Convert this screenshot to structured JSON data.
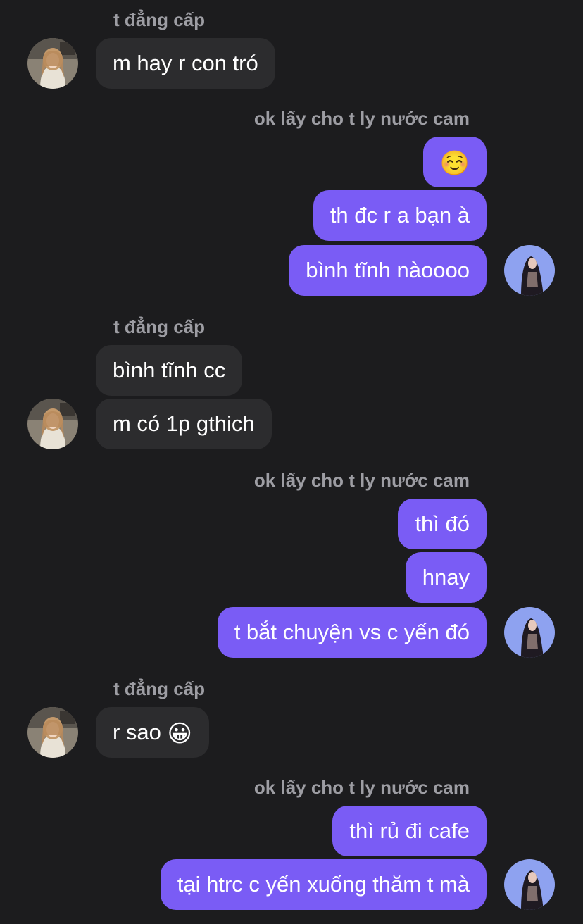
{
  "chat": {
    "senders": {
      "s1": "t đẳng cấp",
      "s2": "ok lấy cho t ly nước cam",
      "s3": "t đẳng cấp",
      "s4": "ok lấy cho t ly nước cam",
      "s5": "t đẳng cấp",
      "s6": "ok lấy cho t ly nước cam"
    },
    "messages": [
      {
        "text": "m hay r con tró",
        "direction": "incoming"
      },
      {
        "text": "☺️",
        "direction": "outgoing"
      },
      {
        "text": "th đc r a bạn à",
        "direction": "outgoing"
      },
      {
        "text": "bình tĩnh nàoooo",
        "direction": "outgoing"
      },
      {
        "text": "bình tĩnh cc",
        "direction": "incoming"
      },
      {
        "text": "m có 1p gthich",
        "direction": "incoming"
      },
      {
        "text": "thì đó",
        "direction": "outgoing"
      },
      {
        "text": "hnay",
        "direction": "outgoing"
      },
      {
        "text": "t bắt chuyện vs c yến đó",
        "direction": "outgoing"
      },
      {
        "text": "r sao",
        "emoji": "😀",
        "direction": "incoming"
      },
      {
        "text": "thì rủ đi cafe",
        "direction": "outgoing"
      },
      {
        "text": "tại htrc c yến xuống thăm t mà",
        "direction": "outgoing"
      }
    ]
  },
  "colors": {
    "background": "#1c1c1e",
    "incoming_bubble": "#2c2c2e",
    "outgoing_bubble": "#7a5cf5",
    "sender_name": "#9d9da3",
    "message_text": "#ffffff"
  },
  "icons": {
    "contact_avatar": "contact-avatar-photo",
    "user_avatar": "user-avatar-photo"
  }
}
